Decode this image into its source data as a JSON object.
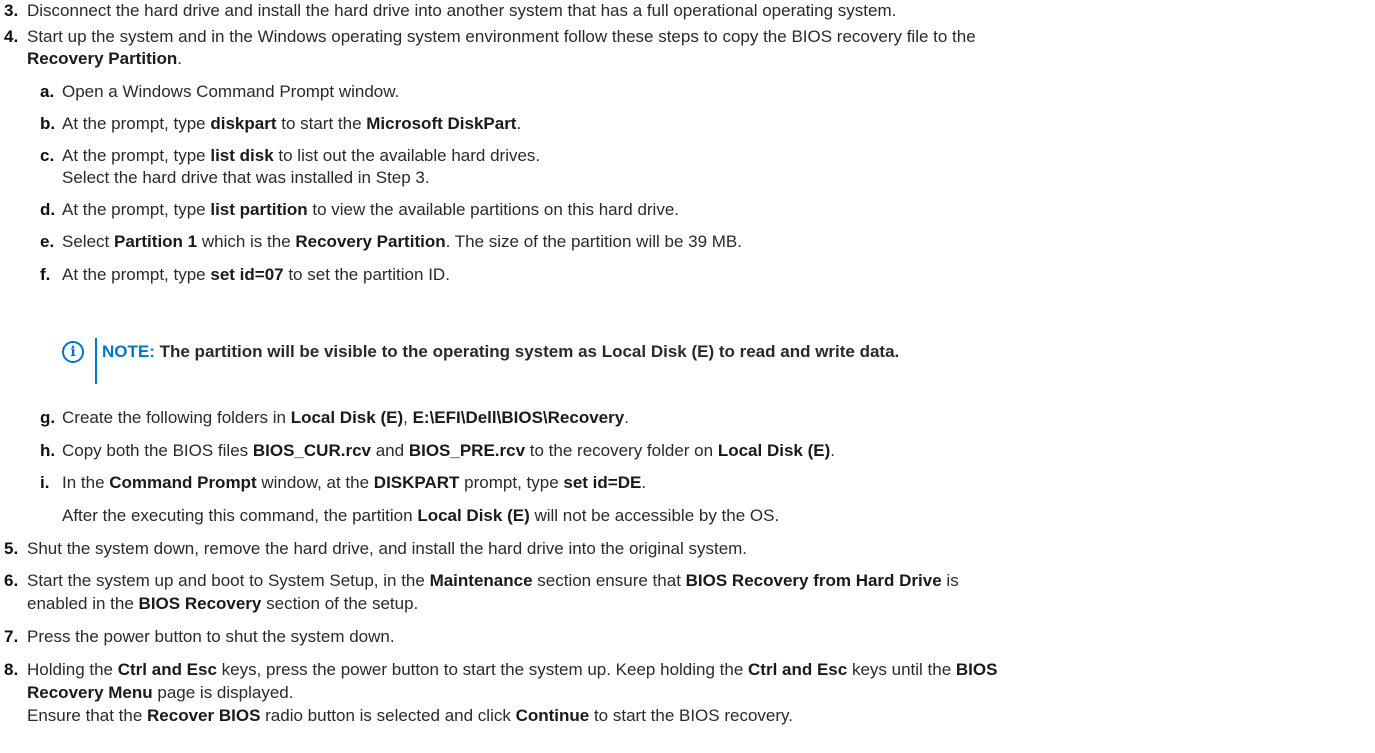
{
  "steps": {
    "s3": {
      "num": "3.",
      "text": "Disconnect the hard drive and install the hard drive into another system that has a full operational operating system."
    },
    "s4": {
      "num": "4.",
      "text_a": "Start up the system and in the Windows operating system environment follow these steps to copy the BIOS recovery file to the",
      "b1": "Recovery Partition",
      "text_b": "."
    },
    "a": {
      "num": "a.",
      "text": "Open a Windows Command Prompt window."
    },
    "b": {
      "num": "b.",
      "t1": "At the prompt, type ",
      "b1": "diskpart",
      "t2": " to start the ",
      "b2": "Microsoft DiskPart",
      "t3": "."
    },
    "c": {
      "num": "c.",
      "t1": "At the prompt, type ",
      "b1": "list disk",
      "t2": " to list out the available hard drives.",
      "line2": "Select the hard drive that was installed in Step 3."
    },
    "d": {
      "num": "d.",
      "t1": "At the prompt, type ",
      "b1": "list partition",
      "t2": " to view the available partitions on this hard drive."
    },
    "e": {
      "num": "e.",
      "t1": "Select ",
      "b1": "Partition 1",
      "t2": " which is the ",
      "b2": "Recovery Partition",
      "t3": ". The size of the partition will be 39 MB."
    },
    "f": {
      "num": "f.",
      "t1": "At the prompt, type ",
      "b1": "set id=07",
      "t2": " to set the partition ID."
    },
    "note": {
      "label": "NOTE:",
      "text": " The partition will be visible to the operating system as Local Disk (E) to read and write data."
    },
    "g": {
      "num": "g.",
      "t1": "Create the following folders in ",
      "b1": "Local Disk (E)",
      "t2": ", ",
      "b2": "E:\\EFI\\Dell\\BIOS\\Recovery",
      "t3": "."
    },
    "h": {
      "num": "h.",
      "t1": "Copy both the BIOS files ",
      "b1": "BIOS_CUR.rcv",
      "t2": " and ",
      "b2": "BIOS_PRE.rcv",
      "t3": " to the recovery folder on ",
      "b3": "Local Disk (E)",
      "t4": "."
    },
    "i": {
      "num": "i.",
      "t1": "In the ",
      "b1": "Command Prompt",
      "t2": " window, at the ",
      "b2": "DISKPART",
      "t3": " prompt, type ",
      "b3": "set id=DE",
      "t4": ".",
      "l2a": "After the executing this command, the partition ",
      "l2b": "Local Disk (E)",
      "l2c": " will not be accessible by the OS."
    },
    "s5": {
      "num": "5.",
      "text": "Shut the system down, remove the hard drive, and install the hard drive into the original system."
    },
    "s6": {
      "num": "6.",
      "t1": "Start the system up and boot to System Setup, in the ",
      "b1": "Maintenance",
      "t2": " section ensure that ",
      "b2": "BIOS Recovery from Hard Drive",
      "t3": " is",
      "l2a": "enabled in the ",
      "l2b": "BIOS Recovery",
      "l2c": " section of the setup."
    },
    "s7": {
      "num": "7.",
      "text": "Press the power button to shut the system down."
    },
    "s8": {
      "num": "8.",
      "t1": "Holding the ",
      "b1": "Ctrl and Esc",
      "t2": " keys, press the power button to start the system up. Keep holding the ",
      "b2": "Ctrl and Esc",
      "t3": " keys until the ",
      "b3": "BIOS",
      "l2a": "Recovery Menu",
      "l2b": " page is displayed.",
      "l3a": "Ensure that the ",
      "l3b": "Recover BIOS",
      "l3c": " radio button is selected and click ",
      "l3d": "Continue",
      "l3e": " to start the BIOS recovery."
    }
  }
}
